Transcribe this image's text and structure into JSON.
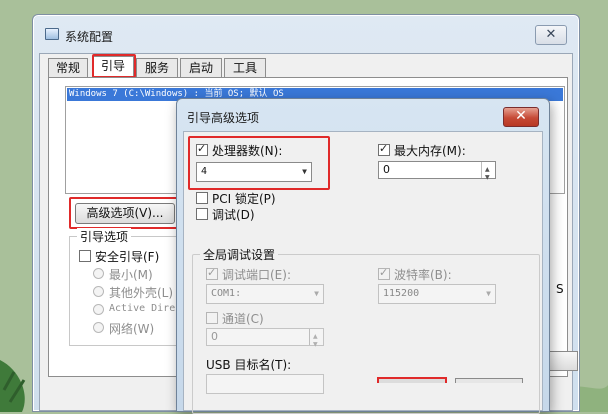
{
  "main_window": {
    "title": "系统配置",
    "close_glyph": "✕",
    "tabs": [
      {
        "label": "常规",
        "active": false
      },
      {
        "label": "引导",
        "active": true
      },
      {
        "label": "服务",
        "active": false
      },
      {
        "label": "启动",
        "active": false
      },
      {
        "label": "工具",
        "active": false
      }
    ],
    "os_entry": "Windows 7 (C:\\Windows) : 当前 OS; 默认 OS",
    "advanced_button": "高级选项(V)...",
    "boot_options": {
      "title": "引导选项",
      "safe_boot": {
        "label": "安全引导(F)",
        "checked": false
      },
      "radios": [
        "最小(M)",
        "其他外壳(L)",
        "Active Direc",
        "网络(W)"
      ]
    },
    "edge_fragment": "S"
  },
  "dialog": {
    "title": "引导高级选项",
    "close_glyph": "✕",
    "num_processors": {
      "label": "处理器数(N):",
      "checked": true,
      "value": "4"
    },
    "max_memory": {
      "label": "最大内存(M):",
      "checked": true,
      "value": "0"
    },
    "pci_lock": {
      "label": "PCI 锁定(P)",
      "checked": false
    },
    "debug": {
      "label": "调试(D)",
      "checked": false
    },
    "global_debug": {
      "title": "全局调试设置",
      "debug_port": {
        "label": "调试端口(E):",
        "checked": true,
        "value": "COM1:"
      },
      "baud_rate": {
        "label": "波特率(B):",
        "checked": true,
        "value": "115200"
      },
      "channel": {
        "label": "通道(C)",
        "checked": false,
        "value": "0"
      },
      "usb_target": {
        "label": "USB 目标名(T):",
        "value": ""
      }
    }
  },
  "colors": {
    "highlight": "#e02a2a",
    "selection": "#3a78d8",
    "close_red": "#c64a36"
  }
}
